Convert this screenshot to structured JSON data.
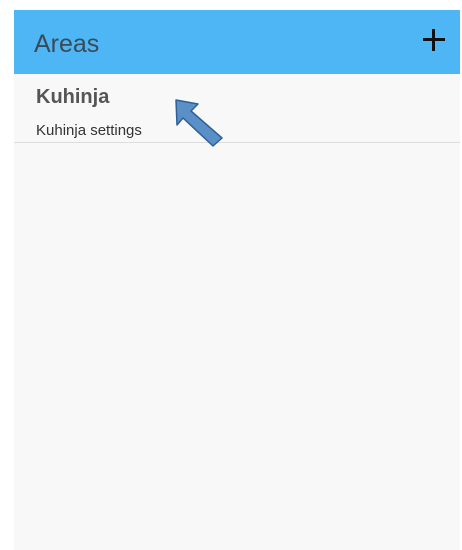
{
  "app_bar": {
    "title": "Areas",
    "add_icon": "plus-icon",
    "color": "#4eb6f5"
  },
  "areas": [
    {
      "name": "Kuhinja",
      "subtitle": "Kuhinja settings"
    }
  ],
  "annotation": {
    "icon": "arrow-pointer-icon",
    "color": "#5b8fc7"
  }
}
